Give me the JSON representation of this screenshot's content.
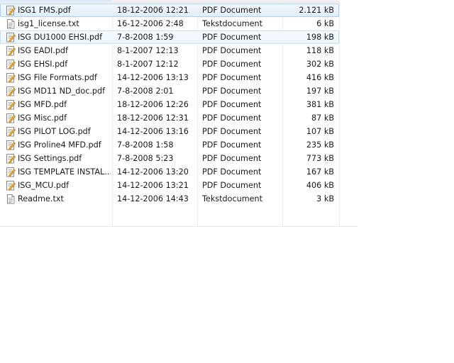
{
  "files": [
    {
      "name": "ISG1 FMS.pdf",
      "modified": "18-12-2006 12:21",
      "type": "PDF Document",
      "size": "2.121 kB",
      "icon": "pdf-file-icon",
      "state": "selected"
    },
    {
      "name": "isg1_license.txt",
      "modified": "16-12-2006 2:48",
      "type": "Tekstdocument",
      "size": "6 kB",
      "icon": "text-file-icon",
      "state": ""
    },
    {
      "name": "ISG DU1000 EHSI.pdf",
      "modified": "7-8-2008 1:59",
      "type": "PDF Document",
      "size": "198 kB",
      "icon": "pdf-file-icon",
      "state": "hover"
    },
    {
      "name": "ISG EADI.pdf",
      "modified": "8-1-2007 12:13",
      "type": "PDF Document",
      "size": "118 kB",
      "icon": "pdf-file-icon",
      "state": ""
    },
    {
      "name": "ISG EHSI.pdf",
      "modified": "8-1-2007 12:12",
      "type": "PDF Document",
      "size": "302 kB",
      "icon": "pdf-file-icon",
      "state": ""
    },
    {
      "name": "ISG File Formats.pdf",
      "modified": "14-12-2006 13:13",
      "type": "PDF Document",
      "size": "416 kB",
      "icon": "pdf-file-icon",
      "state": ""
    },
    {
      "name": "ISG MD11 ND_doc.pdf",
      "modified": "7-8-2008 2:01",
      "type": "PDF Document",
      "size": "197 kB",
      "icon": "pdf-file-icon",
      "state": ""
    },
    {
      "name": "ISG MFD.pdf",
      "modified": "18-12-2006 12:26",
      "type": "PDF Document",
      "size": "381 kB",
      "icon": "pdf-file-icon",
      "state": ""
    },
    {
      "name": "ISG Misc.pdf",
      "modified": "18-12-2006 12:31",
      "type": "PDF Document",
      "size": "87 kB",
      "icon": "pdf-file-icon",
      "state": ""
    },
    {
      "name": "ISG PILOT LOG.pdf",
      "modified": "14-12-2006 13:16",
      "type": "PDF Document",
      "size": "107 kB",
      "icon": "pdf-file-icon",
      "state": ""
    },
    {
      "name": "ISG Proline4 MFD.pdf",
      "modified": "7-8-2008 1:58",
      "type": "PDF Document",
      "size": "235 kB",
      "icon": "pdf-file-icon",
      "state": ""
    },
    {
      "name": "ISG Settings.pdf",
      "modified": "7-8-2008 5:23",
      "type": "PDF Document",
      "size": "773 kB",
      "icon": "pdf-file-icon",
      "state": ""
    },
    {
      "name": "ISG TEMPLATE INSTAL...",
      "modified": "14-12-2006 13:20",
      "type": "PDF Document",
      "size": "167 kB",
      "icon": "pdf-file-icon",
      "state": ""
    },
    {
      "name": "ISG_MCU.pdf",
      "modified": "14-12-2006 13:21",
      "type": "PDF Document",
      "size": "406 kB",
      "icon": "pdf-file-icon",
      "state": ""
    },
    {
      "name": "Readme.txt",
      "modified": "14-12-2006 14:43",
      "type": "Tekstdocument",
      "size": "3 kB",
      "icon": "text-file-icon",
      "state": ""
    }
  ],
  "colors": {
    "selection_border": "#a9d1f4",
    "selection_fill": "#e1eefb",
    "pdf_icon_accent": "#e6a21e"
  }
}
